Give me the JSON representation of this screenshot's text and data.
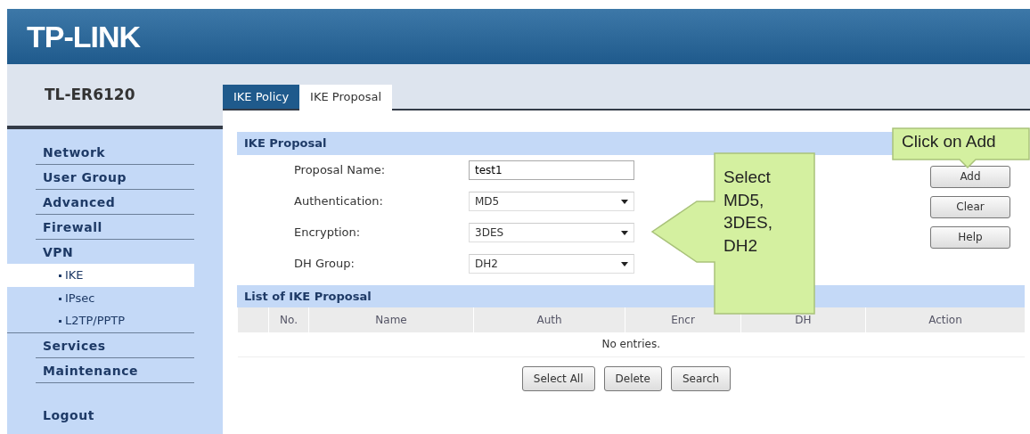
{
  "header": {
    "logo": "TP-LINK"
  },
  "device": {
    "model": "TL-ER6120"
  },
  "sidebar": {
    "items": [
      {
        "label": "Network",
        "selected": false
      },
      {
        "label": "User Group",
        "selected": false
      },
      {
        "label": "Advanced",
        "selected": false
      },
      {
        "label": "Firewall",
        "selected": false
      },
      {
        "label": "VPN",
        "selected": false,
        "children": [
          {
            "label": "IKE",
            "selected": true
          },
          {
            "label": "IPsec",
            "selected": false
          },
          {
            "label": "L2TP/PPTP",
            "selected": false
          }
        ]
      },
      {
        "label": "Services",
        "selected": false
      },
      {
        "label": "Maintenance",
        "selected": false
      },
      {
        "label": "Logout",
        "selected": false,
        "kind": "logout"
      }
    ]
  },
  "tabs": [
    {
      "label": "IKE Policy",
      "selected": false
    },
    {
      "label": "IKE Proposal",
      "selected": true
    }
  ],
  "form": {
    "title": "IKE Proposal",
    "fields": [
      {
        "kind": "text",
        "label": "Proposal Name:",
        "value": "test1"
      },
      {
        "kind": "select",
        "label": "Authentication:",
        "value": "MD5"
      },
      {
        "kind": "select",
        "label": "Encryption:",
        "value": "3DES"
      },
      {
        "kind": "select",
        "label": "DH Group:",
        "value": "DH2"
      }
    ],
    "buttons": [
      "Add",
      "Clear",
      "Help"
    ]
  },
  "list": {
    "title": "List of IKE Proposal",
    "columns": [
      "No.",
      "Name",
      "Auth",
      "Encr",
      "DH",
      "Action"
    ],
    "empty_text": "No entries.",
    "buttons": [
      "Select All",
      "Delete",
      "Search"
    ]
  },
  "callouts": [
    {
      "kind": "down",
      "text": "Click on Add"
    },
    {
      "kind": "left",
      "text": "Select MD5, 3DES, DH2"
    }
  ]
}
